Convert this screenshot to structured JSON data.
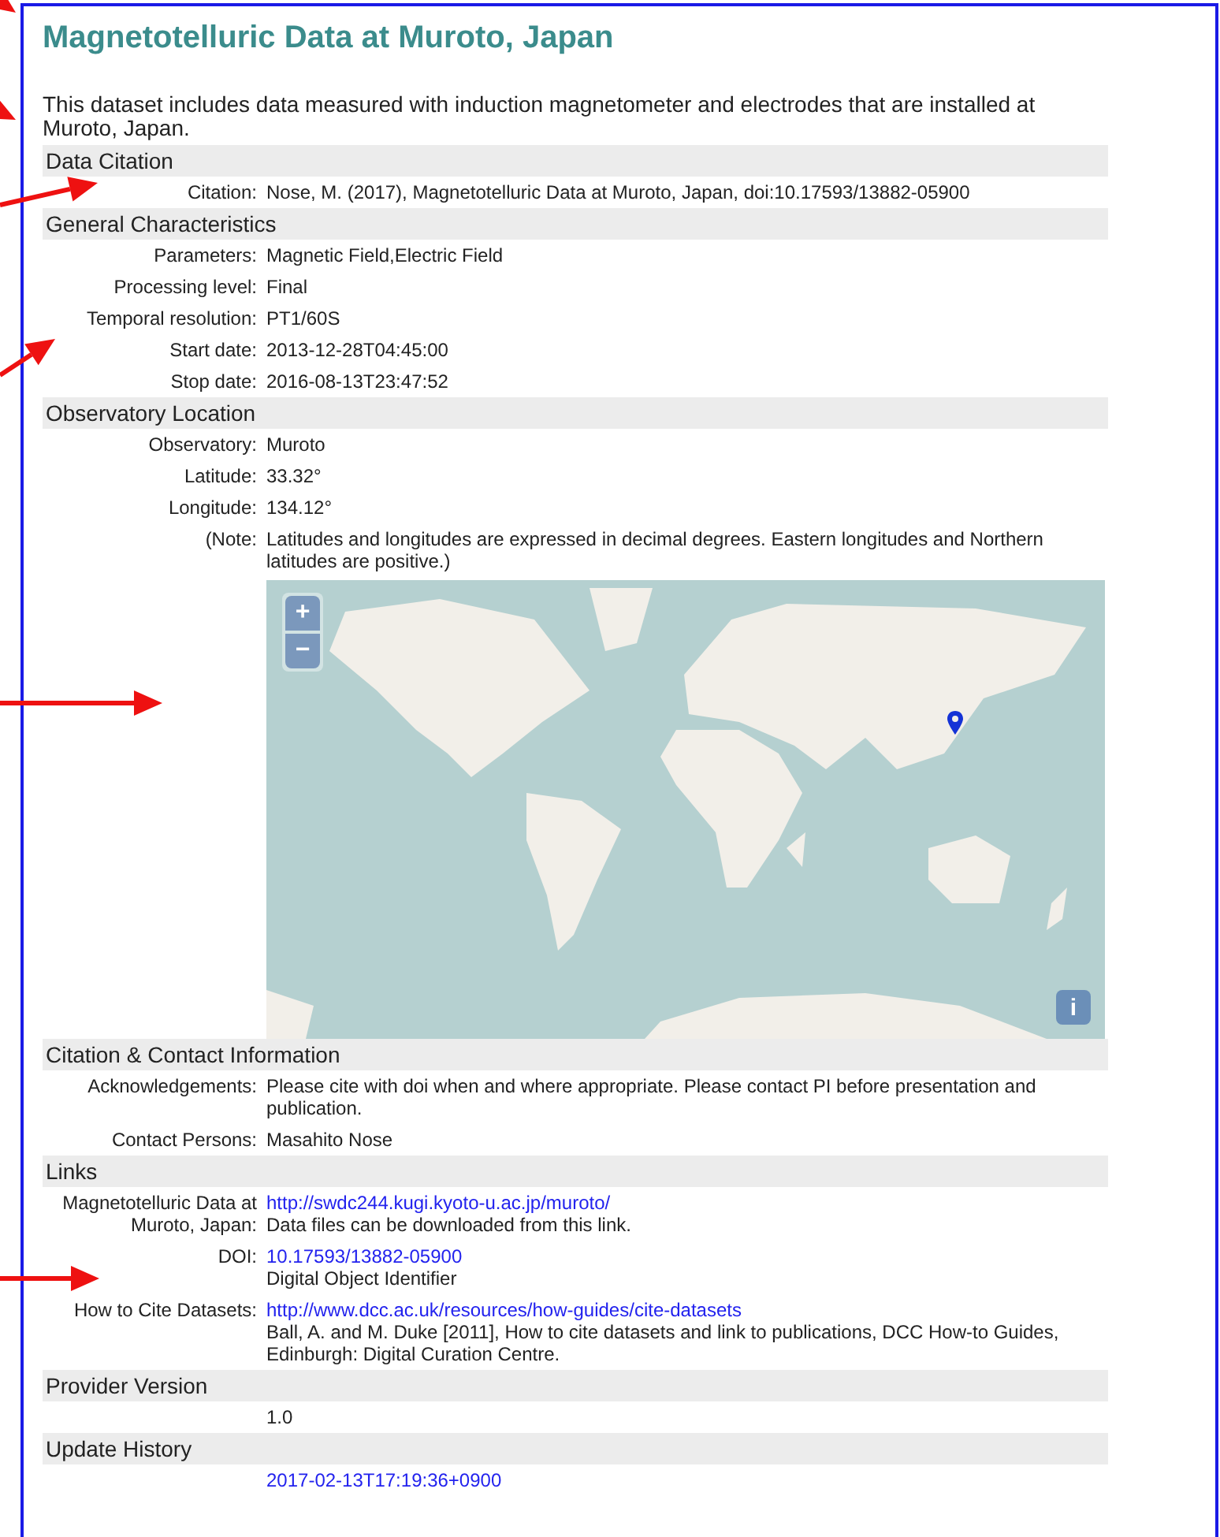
{
  "title": "Magnetotelluric Data at Muroto, Japan",
  "intro": "This dataset includes data measured with induction magnetometer and electrodes that are installed at Muroto, Japan.",
  "sections": [
    {
      "heading": "Data Citation",
      "rows": [
        {
          "kind": "text",
          "label": "Citation:",
          "lines": [
            {
              "kind": "text",
              "text": "Nose, M. (2017), Magnetotelluric Data at Muroto, Japan, doi:10.17593/13882-05900"
            }
          ]
        }
      ]
    },
    {
      "heading": "General Characteristics",
      "rows": [
        {
          "kind": "text",
          "label": "Parameters:",
          "lines": [
            {
              "kind": "text",
              "text": "Magnetic Field,Electric Field"
            }
          ]
        },
        {
          "kind": "text",
          "label": "Processing level:",
          "lines": [
            {
              "kind": "text",
              "text": "Final"
            }
          ]
        },
        {
          "kind": "text",
          "label": "Temporal resolution:",
          "lines": [
            {
              "kind": "text",
              "text": "PT1/60S"
            }
          ]
        },
        {
          "kind": "text",
          "label": "Start date:",
          "lines": [
            {
              "kind": "text",
              "text": "2013-12-28T04:45:00"
            }
          ]
        },
        {
          "kind": "text",
          "label": "Stop date:",
          "lines": [
            {
              "kind": "text",
              "text": "2016-08-13T23:47:52"
            }
          ]
        }
      ]
    },
    {
      "heading": "Observatory Location",
      "rows": [
        {
          "kind": "text",
          "label": "Observatory:",
          "lines": [
            {
              "kind": "text",
              "text": "Muroto"
            }
          ]
        },
        {
          "kind": "text",
          "label": "Latitude:",
          "lines": [
            {
              "kind": "text",
              "text": "33.32°"
            }
          ]
        },
        {
          "kind": "text",
          "label": "Longitude:",
          "lines": [
            {
              "kind": "text",
              "text": "134.12°"
            }
          ]
        },
        {
          "kind": "text",
          "label": "(Note:",
          "lines": [
            {
              "kind": "text",
              "text": "Latitudes and longitudes are expressed in decimal degrees. Eastern longitudes and Northern latitudes are positive.)"
            }
          ]
        },
        {
          "kind": "map",
          "zoom_in": "+",
          "zoom_out": "−",
          "info": "i"
        }
      ]
    },
    {
      "heading": "Citation & Contact Information",
      "rows": [
        {
          "kind": "text",
          "label": "Acknowledgements:",
          "lines": [
            {
              "kind": "text",
              "text": "Please cite with doi when and where appropriate. Please contact PI before presentation and publication."
            }
          ]
        },
        {
          "kind": "text",
          "label": "Contact Persons:",
          "lines": [
            {
              "kind": "text",
              "text": "Masahito Nose"
            }
          ]
        }
      ]
    },
    {
      "heading": "Links",
      "rows": [
        {
          "kind": "text",
          "label": "Magnetotelluric Data at Muroto, Japan:",
          "lines": [
            {
              "kind": "link",
              "text": "http://swdc244.kugi.kyoto-u.ac.jp/muroto/"
            },
            {
              "kind": "text",
              "text": "Data files can be downloaded from this link."
            }
          ]
        },
        {
          "kind": "text",
          "label": "DOI:",
          "lines": [
            {
              "kind": "link",
              "text": "10.17593/13882-05900"
            },
            {
              "kind": "text",
              "text": "Digital Object Identifier"
            }
          ]
        },
        {
          "kind": "text",
          "label": "How to Cite Datasets:",
          "lines": [
            {
              "kind": "link",
              "text": "http://www.dcc.ac.uk/resources/how-guides/cite-datasets"
            },
            {
              "kind": "text",
              "text": "Ball, A. and M. Duke [2011], How to cite datasets and link to publications, DCC How-to Guides, Edinburgh: Digital Curation Centre."
            }
          ]
        }
      ]
    },
    {
      "heading": "Provider Version",
      "rows": [
        {
          "kind": "text",
          "lines": [
            {
              "kind": "text",
              "text": "1.0"
            }
          ]
        }
      ]
    },
    {
      "heading": "Update History",
      "rows": [
        {
          "kind": "text",
          "lines": [
            {
              "kind": "link",
              "text": "2017-02-13T17:19:36+0900"
            }
          ]
        }
      ]
    }
  ]
}
